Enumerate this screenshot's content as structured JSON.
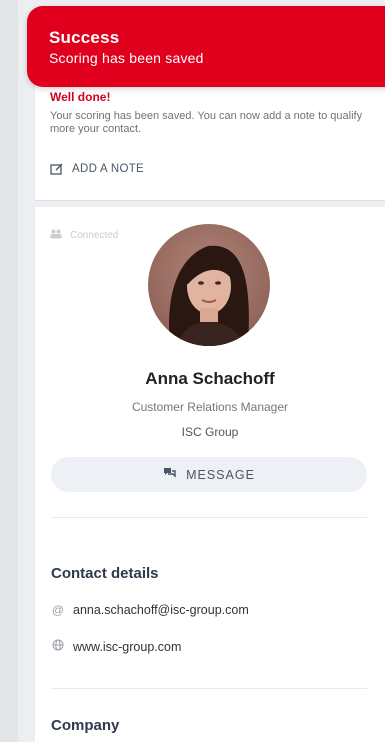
{
  "toast": {
    "title": "Success",
    "message": "Scoring has been saved"
  },
  "scoring_card": {
    "heading": "Well done!",
    "text": "Your scoring has been saved. You can now add a note to qualify more your contact.",
    "add_note_label": "ADD A NOTE"
  },
  "profile": {
    "connected_label": "Connected",
    "name": "Anna Schachoff",
    "role": "Customer Relations Manager",
    "company": "ISC Group",
    "message_button": "MESSAGE"
  },
  "contact_details": {
    "title": "Contact details",
    "email": "anna.schachoff@isc-group.com",
    "website": "www.isc-group.com"
  },
  "company_section": {
    "title": "Company"
  },
  "colors": {
    "accent": "#e0001e",
    "text_dark": "#2f3a4c"
  },
  "icons": {
    "note": "note-edit-icon",
    "connected": "people-icon",
    "message": "chat-icon",
    "email": "at-icon",
    "website": "globe-icon"
  }
}
